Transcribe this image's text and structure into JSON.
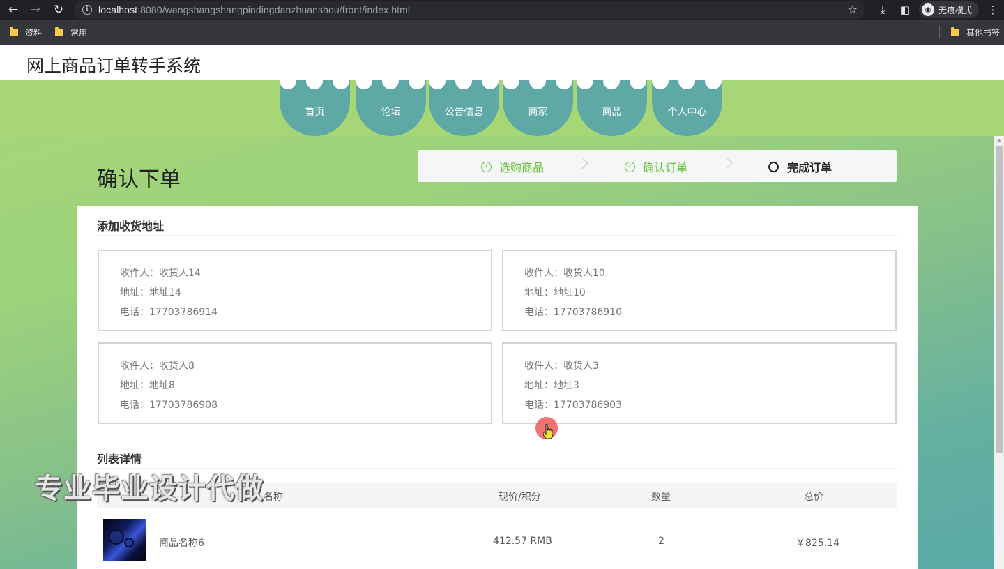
{
  "browser": {
    "url_host": "localhost",
    "url_path": ":8080/wangshangshangpindingdanzhuanshou/front/index.html",
    "incognito_label": "无痕模式",
    "bookmarks": [
      "资料",
      "常用"
    ],
    "other_bookmarks": "其他书签"
  },
  "site": {
    "title": "网上商品订单转手系统",
    "nav": [
      "首页",
      "论坛",
      "公告信息",
      "商家",
      "商品",
      "个人中心"
    ]
  },
  "page": {
    "heading": "确认下单",
    "steps": [
      {
        "label": "选购商品",
        "status": "done"
      },
      {
        "label": "确认订单",
        "status": "done"
      },
      {
        "label": "完成订单",
        "status": "current"
      }
    ]
  },
  "address_section": {
    "title": "添加收货地址",
    "cards": [
      {
        "recipient": "收件人：收货人14",
        "address": "地址：地址14",
        "phone": "电话：17703786914"
      },
      {
        "recipient": "收件人：收货人10",
        "address": "地址：地址10",
        "phone": "电话：17703786910"
      },
      {
        "recipient": "收件人：收货人8",
        "address": "地址：地址8",
        "phone": "电话：17703786908"
      },
      {
        "recipient": "收件人：收货人3",
        "address": "地址：地址3",
        "phone": "电话：17703786903"
      }
    ]
  },
  "list_section": {
    "title": "列表详情",
    "columns": [
      "名称",
      "现价/积分",
      "数量",
      "总价"
    ],
    "rows": [
      {
        "name": "商品名称6",
        "price": "412.57 RMB",
        "quantity": "2",
        "total": "￥825.14"
      }
    ]
  },
  "watermark": "专业毕业设计代做",
  "colors": {
    "nav_item": "#5ea8a6",
    "nav_band": "#a6d676",
    "step_done": "#67c23a"
  }
}
